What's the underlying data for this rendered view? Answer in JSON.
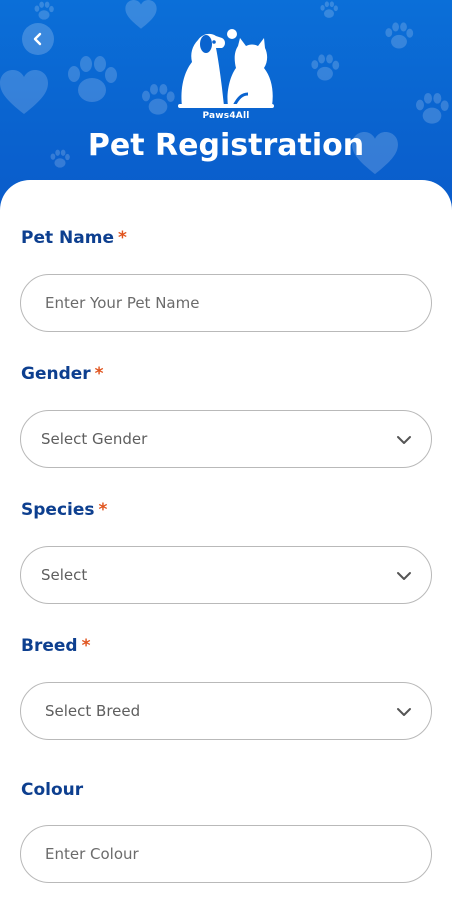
{
  "header": {
    "logo_text": "Paws4All",
    "title": "Pet Registration",
    "background_color": "#0a63cf",
    "icons": [
      "back-arrow-icon",
      "dog-cat-logo-icon",
      "paw-icon",
      "heart-icon"
    ]
  },
  "form": {
    "pet_name": {
      "label": "Pet Name",
      "required_mark": "*",
      "placeholder": "Enter Your Pet Name",
      "value": ""
    },
    "gender": {
      "label": "Gender",
      "required_mark": "*",
      "selected": "Select Gender"
    },
    "species": {
      "label": "Species",
      "required_mark": "*",
      "selected": "Select"
    },
    "breed": {
      "label": "Breed",
      "required_mark": "*",
      "selected": "Select Breed"
    },
    "colour": {
      "label": "Colour",
      "placeholder": "Enter Colour",
      "value": ""
    }
  },
  "colors": {
    "label": "#0d3f8f",
    "required": "#e0541e",
    "border": "#b9b9b9"
  }
}
